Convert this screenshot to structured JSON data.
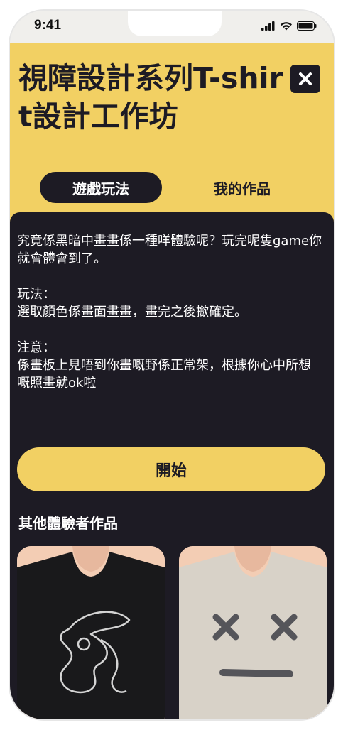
{
  "status_bar": {
    "time": "9:41"
  },
  "header": {
    "title": "視障設計系列T-shirt設計工作坊",
    "close_icon": "close-icon"
  },
  "tabs": [
    {
      "label": "遊戲玩法",
      "active": true
    },
    {
      "label": "我的作品",
      "active": false
    }
  ],
  "description": {
    "intro": "究竟係黑暗中畫畫係一種咩體驗呢？玩完呢隻game你就會體會到了。",
    "howto": "玩法：\n選取顏色係畫面畫畫，畫完之後撳確定。",
    "note": "注意：\n係畫板上見唔到你畫嘅野係正常架，根據你心中所想嘅照畫就ok啦"
  },
  "start_button": {
    "label": "開始"
  },
  "gallery": {
    "title": "其他體驗者作品",
    "items": [
      {
        "shirt_color": "#19191b",
        "artwork": "abstract-line-drawing"
      },
      {
        "shirt_color": "#d8d2c8",
        "artwork": "x-eyes-smiley"
      }
    ]
  },
  "colors": {
    "accent": "#f2d063",
    "dark": "#1d1b24",
    "skin": "#f3cdb4"
  }
}
